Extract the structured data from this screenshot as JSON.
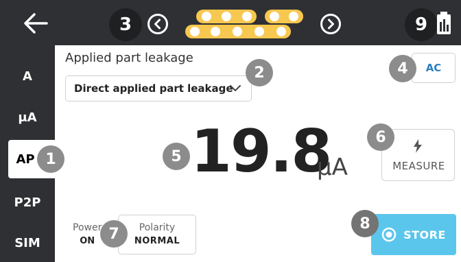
{
  "topbar": {
    "markers": {
      "three": "3",
      "nine": "9"
    }
  },
  "sidebar": {
    "items": [
      {
        "label": "A"
      },
      {
        "label": "μA"
      },
      {
        "label": "AP"
      },
      {
        "label": "P2P"
      },
      {
        "label": "SIM"
      }
    ]
  },
  "main": {
    "title": "Applied part leakage",
    "mode_select": {
      "value": "Direct applied part leakage"
    },
    "ac_label": "AC",
    "reading": {
      "value": "19.8",
      "unit": "μA"
    },
    "measure_label": "MEASURE",
    "store_label": "STORE",
    "power": {
      "label": "Power",
      "value": "ON"
    },
    "polarity": {
      "label": "Polarity",
      "value": "NORMAL"
    }
  },
  "markers": {
    "one": "1",
    "two": "2",
    "four": "4",
    "five": "5",
    "six": "6",
    "seven": "7",
    "eight": "8"
  },
  "colors": {
    "bar": "#2f3033",
    "accent": "#5bc6ec",
    "link": "#2a7fbf",
    "dot": "#f7c84f"
  }
}
